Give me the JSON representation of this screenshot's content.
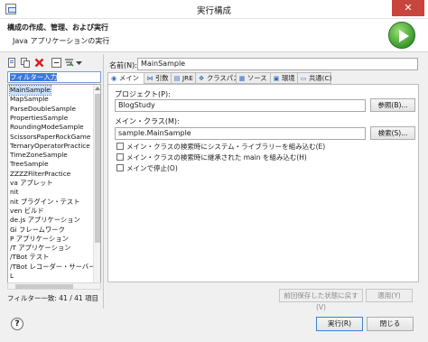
{
  "window": {
    "title": "実行構成",
    "close": "✕"
  },
  "header": {
    "title": "構成の作成、管理、および実行",
    "subtitle": "Java アプリケーションの実行"
  },
  "left_pane": {
    "toolbar_icons": [
      "new-config-icon",
      "duplicate-icon",
      "delete-icon",
      "collapse-all-icon",
      "filter-icon",
      "dropdown-icon"
    ],
    "filter_placeholder": "フィルター入力",
    "tree_items": [
      "MainSample",
      "MapSample",
      "ParseDoubleSample",
      "PropertiesSample",
      "RoundingModeSample",
      "ScissorsPaperRockGame",
      "TernaryOperatorPractice",
      "TimeZoneSample",
      "TreeSample",
      "ZZZZFilterPractice",
      "va アプレット",
      "nit",
      "nit プラグイン・テスト",
      "ven ビルド",
      "de.js アプリケーション",
      "Gi フレームワーク",
      "P アプリケーション",
      "/T アプリケーション",
      "/TBot テスト",
      "/TBot レコーダー・サーバー",
      "L"
    ],
    "selected_index": 0,
    "filter_status": "フィルター一致: 41 / 41 項目"
  },
  "config": {
    "name_label": "名前(N):",
    "name_value": "MainSample",
    "tabs": [
      {
        "label": "メイン",
        "icon": "main-tab-icon",
        "glyph": "◉"
      },
      {
        "label": "引数",
        "icon": "arguments-tab-icon",
        "glyph": "⋈"
      },
      {
        "label": "JRE",
        "icon": "jre-tab-icon",
        "glyph": "▤"
      },
      {
        "label": "クラスパス",
        "icon": "classpath-tab-icon",
        "glyph": "✥"
      },
      {
        "label": "ソース",
        "icon": "source-tab-icon",
        "glyph": "▦"
      },
      {
        "label": "環境",
        "icon": "environment-tab-icon",
        "glyph": "▣"
      },
      {
        "label": "共通(C)",
        "icon": "common-tab-icon",
        "glyph": "▭"
      }
    ],
    "project_label": "プロジェクト(P):",
    "project_value": "BlogStudy",
    "browse_button": "参照(B)...",
    "main_class_label": "メイン・クラス(M):",
    "main_class_value": "sample.MainSample",
    "search_button": "検索(S)...",
    "checkboxes": [
      "メイン・クラスの検索時にシステム・ライブラリーを組み込む(E)",
      "メイン・クラスの検索時に継承された main を組み込む(H)",
      "メインで停止(O)"
    ],
    "revert_button": "前回保存した状態に戻す(V)",
    "apply_button": "適用(Y)"
  },
  "footer": {
    "run_button": "実行(R)",
    "close_button": "閉じる",
    "help": "?"
  }
}
